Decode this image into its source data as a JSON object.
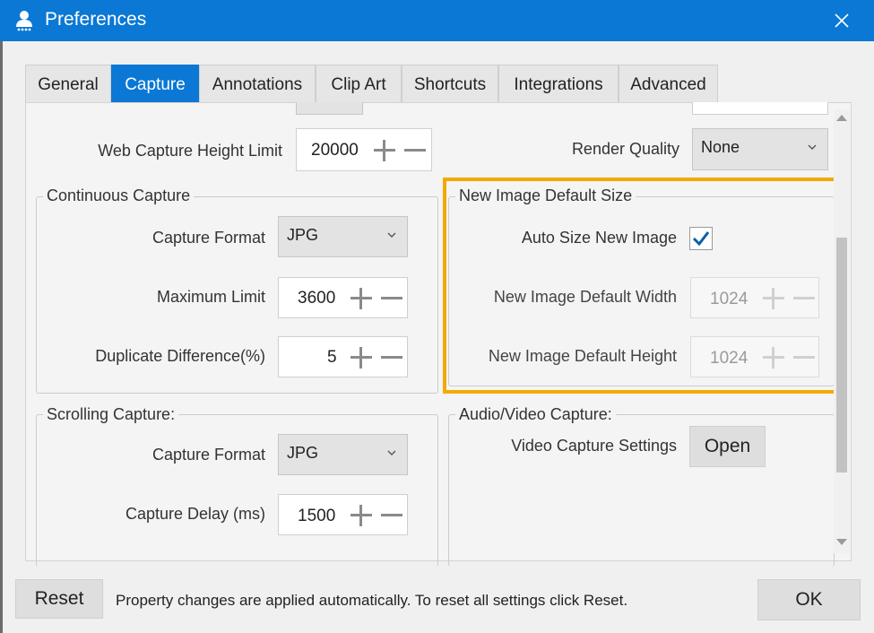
{
  "window": {
    "title": "Preferences",
    "close_label": "×"
  },
  "tabs": [
    {
      "label": "General",
      "active": false
    },
    {
      "label": "Capture",
      "active": true
    },
    {
      "label": "Annotations",
      "active": false
    },
    {
      "label": "Clip Art",
      "active": false
    },
    {
      "label": "Shortcuts",
      "active": false
    },
    {
      "label": "Integrations",
      "active": false
    },
    {
      "label": "Advanced",
      "active": false
    }
  ],
  "web_capture": {
    "label": "Web Capture Height Limit",
    "value": "20000"
  },
  "render_quality": {
    "label": "Render Quality",
    "value": "None"
  },
  "continuous_capture": {
    "title": "Continuous Capture",
    "format_label": "Capture Format",
    "format_value": "JPG",
    "max_limit_label": "Maximum Limit",
    "max_limit_value": "3600",
    "dup_diff_label": "Duplicate Difference(%)",
    "dup_diff_value": "5"
  },
  "new_image": {
    "title": "New Image Default Size",
    "auto_size_label": "Auto Size New Image",
    "auto_size_checked": true,
    "width_label": "New Image Default Width",
    "width_value": "1024",
    "height_label": "New Image Default Height",
    "height_value": "1024"
  },
  "scrolling_capture": {
    "title": "Scrolling Capture:",
    "format_label": "Capture Format",
    "format_value": "JPG",
    "delay_label": "Capture Delay (ms)",
    "delay_value": "1500"
  },
  "audio_video": {
    "title": "Audio/Video Capture:",
    "settings_label": "Video Capture Settings",
    "open_label": "Open"
  },
  "footer": {
    "reset_label": "Reset",
    "message": "Property changes are applied automatically. To reset all settings click Reset.",
    "ok_label": "OK"
  },
  "colors": {
    "accent": "#0a78d4",
    "highlight": "#f5a800"
  }
}
